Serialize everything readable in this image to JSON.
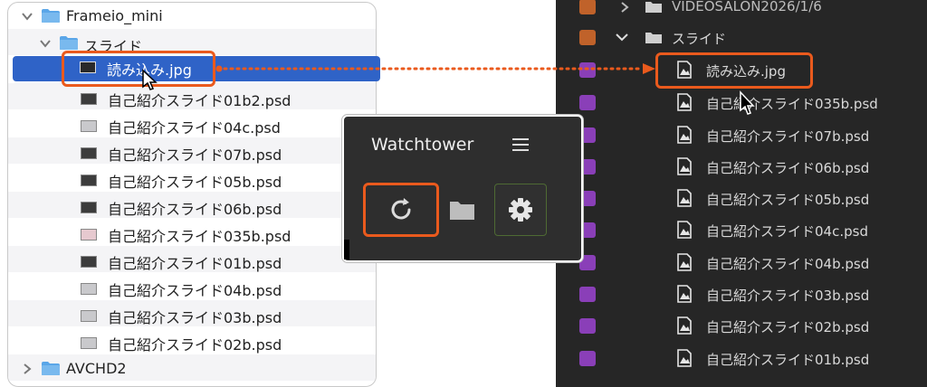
{
  "finder": {
    "root_folder": "Frameio_mini",
    "sub_folder": "スライド",
    "selected_file": "読み込み.jpg",
    "files": [
      "自己紹介スライド01b2.psd",
      "自己紹介スライド04c.psd",
      "自己紹介スライド07b.psd",
      "自己紹介スライド05b.psd",
      "自己紹介スライド06b.psd",
      "自己紹介スライド035b.psd",
      "自己紹介スライド01b.psd",
      "自己紹介スライド04b.psd",
      "自己紹介スライド03b.psd",
      "自己紹介スライド02b.psd"
    ],
    "bottom_folder": "AVCHD2"
  },
  "panel": {
    "top_folder": "VIDEOSALON2026/1/6",
    "folder": "スライド",
    "selected_file": "読み込み.jpg",
    "files": [
      "自己紹介スライド035b.psd",
      "自己紹介スライド07b.psd",
      "自己紹介スライド06b.psd",
      "自己紹介スライド05b.psd",
      "自己紹介スライド04c.psd",
      "自己紹介スライド04b.psd",
      "自己紹介スライド03b.psd",
      "自己紹介スライド02b.psd",
      "自己紹介スライド01b.psd"
    ]
  },
  "watchtower": {
    "title": "Watchtower",
    "menu_icon": "hamburger-icon",
    "buttons": [
      "refresh-icon",
      "folder-icon",
      "gear-icon"
    ]
  },
  "colors": {
    "highlight": "#ea5a1d",
    "selection": "#2f63c7",
    "finder_folder": "#5aa6e8",
    "panel_bg": "#262626",
    "label_orange": "#c0622a",
    "label_purple": "#8a3fb8"
  }
}
